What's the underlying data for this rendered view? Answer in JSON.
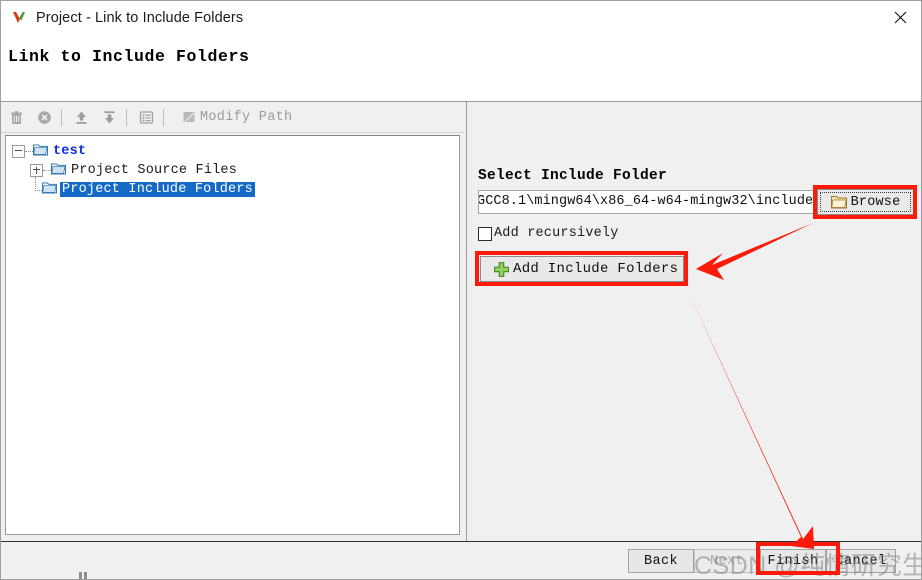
{
  "window": {
    "title": "Project - Link to Include Folders",
    "app_icon": "v-logo-icon",
    "close_label": "close-icon"
  },
  "banner": {
    "heading": "Link to Include Folders"
  },
  "toolbar": {
    "buttons": [
      {
        "name": "delete-icon",
        "tooltip": "Delete"
      },
      {
        "name": "remove-icon",
        "tooltip": "Remove"
      },
      {
        "name": "move-up-icon",
        "tooltip": "Move Up"
      },
      {
        "name": "move-down-icon",
        "tooltip": "Move Down"
      },
      {
        "name": "properties-icon",
        "tooltip": "Properties"
      }
    ],
    "modify_path_label": "Modify Path",
    "modify_path_icon": "edit-pencil-icon",
    "modify_path_disabled": true
  },
  "tree": {
    "root": {
      "label": "test",
      "expanded": true
    },
    "children": [
      {
        "label": "Project Source Files",
        "expanded": false,
        "selected": false
      },
      {
        "label": "Project Include Folders",
        "expanded": false,
        "selected": true
      }
    ]
  },
  "right_panel": {
    "section_title": "Select Include Folder",
    "path_value": "GCC8.1\\mingw64\\x86_64-w64-mingw32\\include",
    "path_placeholder": "",
    "browse_label": "Browse",
    "browse_icon": "folder-icon",
    "browse_focused": true,
    "recursive_label": "Add recursively",
    "recursive_checked": false,
    "add_label": "Add Include Folders",
    "add_icon": "plus-green-icon"
  },
  "footer": {
    "back_label": "Back",
    "next_label": "Next",
    "next_disabled": true,
    "finish_label": "Finish",
    "cancel_label": "Cancel"
  },
  "annotations": {
    "watermark": "CSDN @纯情研究生",
    "highlight_color": "#fc1a0b",
    "boxes": [
      "browse-button",
      "add-include-folders-button",
      "finish-button"
    ],
    "arrows": [
      "browse-to-add",
      "add-to-finish"
    ]
  }
}
